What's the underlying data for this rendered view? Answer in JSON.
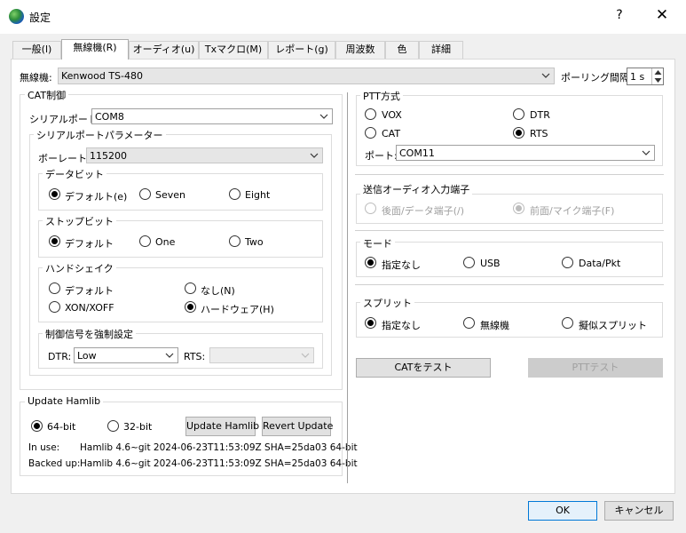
{
  "window": {
    "title": "設定",
    "help": "?",
    "close": "✕"
  },
  "tabs": [
    "一般(l)",
    "無線機(R)",
    "オーディオ(u)",
    "Txマクロ(M)",
    "レポート(g)",
    "周波数",
    "色",
    "詳細"
  ],
  "radio_row": {
    "label": "無線機:",
    "value": "Kenwood TS-480",
    "polling_label": "ポーリング間隔:",
    "polling_value": "1 s"
  },
  "cat": {
    "title": "CAT制御",
    "serial_label": "シリアルポート:",
    "serial_value": "COM8",
    "params_title": "シリアルポートパラメーター",
    "baud_label": "ボーレート:",
    "baud_value": "115200",
    "databits": {
      "title": "データビット",
      "opts": [
        "デフォルト(e)",
        "Seven",
        "Eight"
      ]
    },
    "stopbits": {
      "title": "ストップビット",
      "opts": [
        "デフォルト",
        "One",
        "Two"
      ]
    },
    "handshake": {
      "title": "ハンドシェイク",
      "opts": [
        "デフォルト",
        "なし(N)",
        "XON/XOFF",
        "ハードウェア(H)"
      ]
    },
    "force": {
      "title": "制御信号を強制設定",
      "dtr_label": "DTR:",
      "dtr_value": "Low",
      "rts_label": "RTS:",
      "rts_value": ""
    }
  },
  "hamlib": {
    "title": "Update Hamlib",
    "opts": [
      "64-bit",
      "32-bit"
    ],
    "update_btn": "Update Hamlib",
    "revert_btn": "Revert Update",
    "inuse_label": "In use:",
    "inuse_value": "Hamlib 4.6~git 2024-06-23T11:53:09Z SHA=25da03 64-bit",
    "backup_label": "Backed up:",
    "backup_value": "Hamlib 4.6~git 2024-06-23T11:53:09Z SHA=25da03 64-bit"
  },
  "ptt": {
    "title": "PTT方式",
    "opts": [
      "VOX",
      "DTR",
      "CAT",
      "RTS"
    ],
    "port_label": "ポート:",
    "port_value": "COM11"
  },
  "audio": {
    "title": "送信オーディオ入力端子",
    "opts": [
      "後面/データ端子(/)",
      "前面/マイク端子(F)"
    ]
  },
  "mode": {
    "title": "モード",
    "opts": [
      "指定なし",
      "USB",
      "Data/Pkt"
    ]
  },
  "split": {
    "title": "スプリット",
    "opts": [
      "指定なし",
      "無線機",
      "擬似スプリット"
    ]
  },
  "test": {
    "cat_btn": "CATをテスト",
    "ptt_btn": "PTTテスト"
  },
  "footer": {
    "ok": "OK",
    "cancel": "キャンセル"
  }
}
